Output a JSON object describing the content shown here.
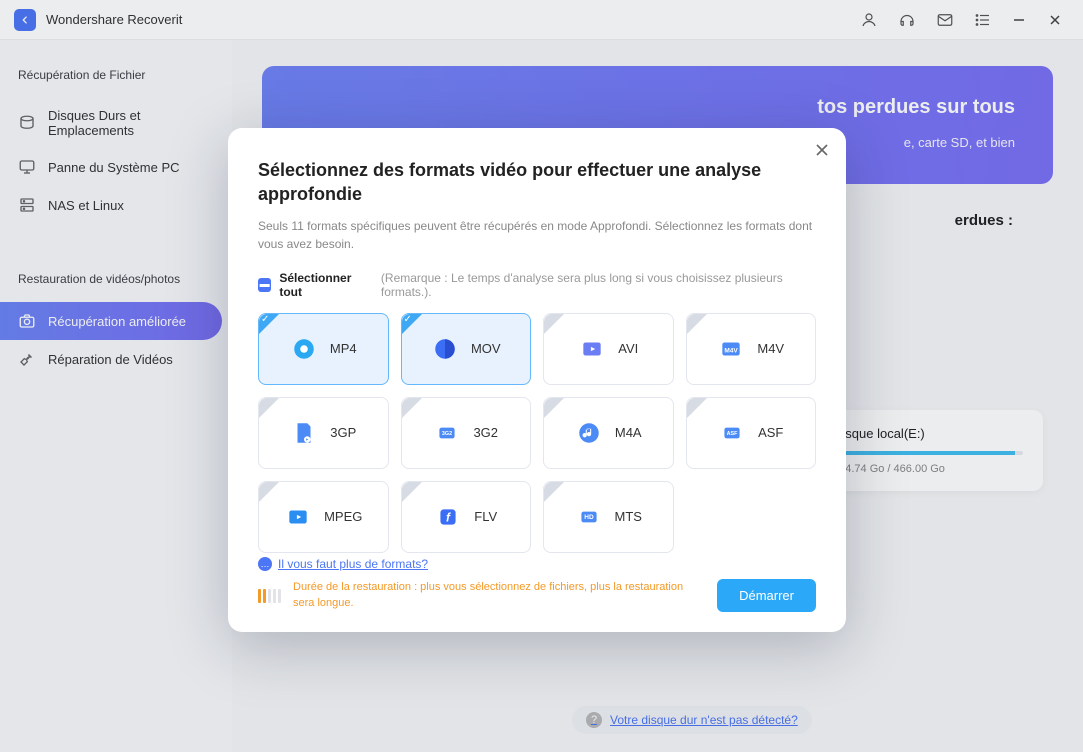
{
  "app": {
    "title": "Wondershare Recoverit"
  },
  "sidebar": {
    "heading1": "Récupération de Fichier",
    "items1": [
      {
        "label": "Disques Durs et Emplacements"
      },
      {
        "label": "Panne du Système PC"
      },
      {
        "label": "NAS et Linux"
      }
    ],
    "heading2": "Restauration de vidéos/photos",
    "items2": [
      {
        "label": "Récupération améliorée"
      },
      {
        "label": "Réparation de Vidéos"
      }
    ]
  },
  "banner": {
    "title_suffix": "tos perdues sur tous",
    "desc_suffix": "e, carte SD, et bien"
  },
  "subtitle_suffix": "erdues :",
  "disk": {
    "name": "Disque local(E:)",
    "size": "454.74 Go / 466.00 Go"
  },
  "detect_link": "Votre disque dur n'est pas détecté?",
  "modal": {
    "title": "Sélectionnez des formats vidéo pour effectuer une analyse approfondie",
    "desc": "Seuls 11 formats spécifiques peuvent être récupérés en mode Approfondi. Sélectionnez les formats dont vous avez besoin.",
    "select_all": "Sélectionner tout",
    "select_note": "(Remarque : Le temps d'analyse sera plus long si vous choisissez plusieurs formats.).",
    "formats": [
      {
        "label": "MP4",
        "selected": true
      },
      {
        "label": "MOV",
        "selected": true
      },
      {
        "label": "AVI",
        "selected": false
      },
      {
        "label": "M4V",
        "selected": false
      },
      {
        "label": "3GP",
        "selected": false
      },
      {
        "label": "3G2",
        "selected": false
      },
      {
        "label": "M4A",
        "selected": false
      },
      {
        "label": "ASF",
        "selected": false
      },
      {
        "label": "MPEG",
        "selected": false
      },
      {
        "label": "FLV",
        "selected": false
      },
      {
        "label": "MTS",
        "selected": false
      }
    ],
    "more_link": "Il vous faut plus de formats?",
    "duration_note": "Durée de la restauration : plus vous sélectionnez de fichiers, plus la restauration sera longue.",
    "start": "Démarrer"
  },
  "colors": {
    "accent": "#4c76f5"
  }
}
